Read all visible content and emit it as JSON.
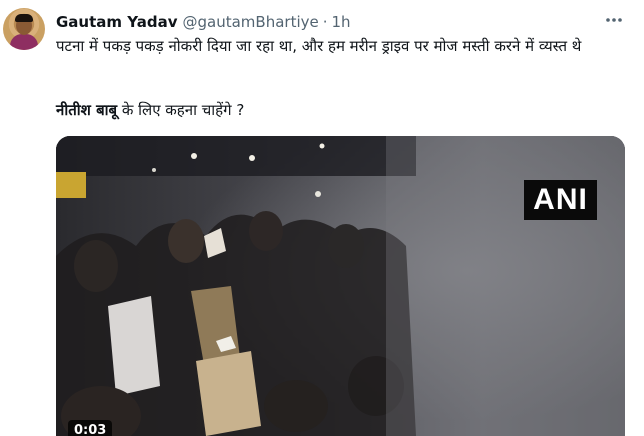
{
  "author": {
    "name": "Gautam Yadav",
    "handle": "@gautamBhartiye",
    "separator": "·",
    "time": "1h"
  },
  "tweet": {
    "line1": "पटना में पकड़ पकड़ नोकरी दिया जा रहा था, और हम मरीन ड्राइव पर मोज मस्ती करने में व्यस्त थे",
    "line2_bold": "नीतीश बाबू",
    "line2_rest": " के लिए कहना चाहेंगे ?"
  },
  "media": {
    "watermark": "ANI",
    "duration": "0:03"
  },
  "icons": {
    "more": "more-horizontal-icon",
    "avatar": "profile-avatar"
  },
  "colors": {
    "text_primary": "#0f1419",
    "text_secondary": "#536471",
    "background": "#ffffff"
  }
}
